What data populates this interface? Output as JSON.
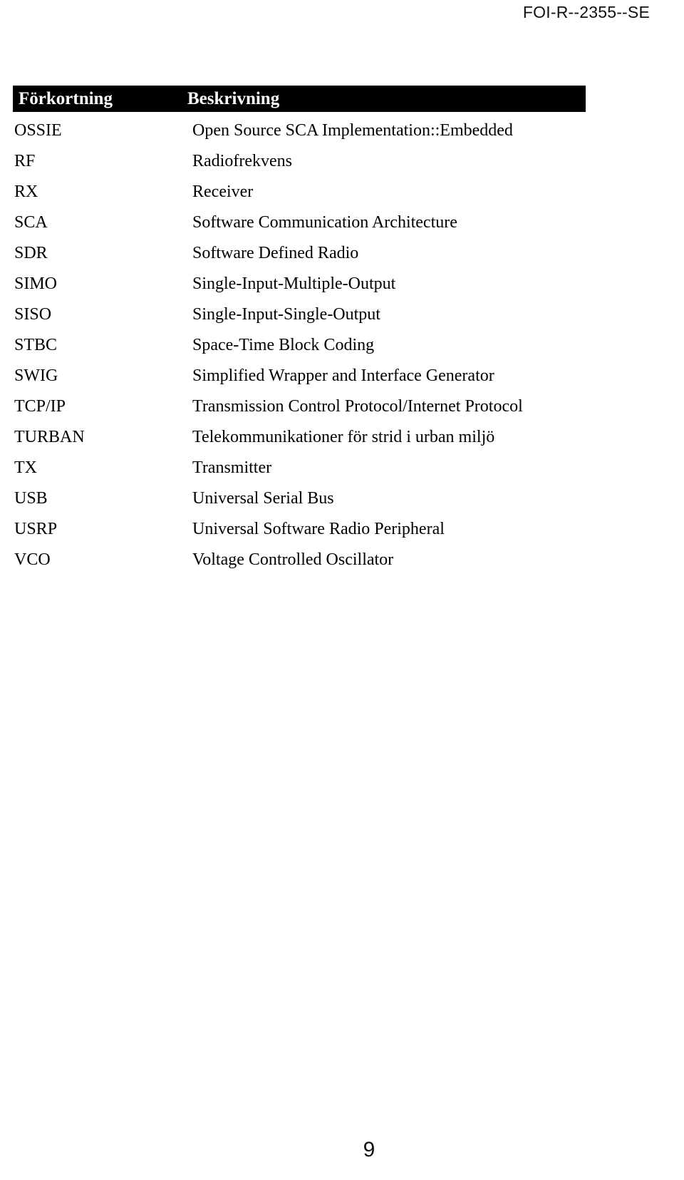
{
  "document": {
    "header_id": "FOI-R--2355--SE",
    "page_number": "9"
  },
  "table": {
    "columns": {
      "abbreviation": "Förkortning",
      "description": "Beskrivning"
    },
    "header_background": "#000000",
    "header_text_color": "#ffffff",
    "rows": [
      {
        "abbreviation": "OSSIE",
        "description": "Open Source SCA Implementation::Embedded"
      },
      {
        "abbreviation": "RF",
        "description": "Radiofrekvens"
      },
      {
        "abbreviation": "RX",
        "description": "Receiver"
      },
      {
        "abbreviation": "SCA",
        "description": "Software Communication Architecture"
      },
      {
        "abbreviation": "SDR",
        "description": "Software Defined Radio"
      },
      {
        "abbreviation": "SIMO",
        "description": "Single-Input-Multiple-Output"
      },
      {
        "abbreviation": "SISO",
        "description": "Single-Input-Single-Output"
      },
      {
        "abbreviation": "STBC",
        "description": "Space-Time Block Coding"
      },
      {
        "abbreviation": "SWIG",
        "description": "Simplified Wrapper and Interface Generator"
      },
      {
        "abbreviation": "TCP/IP",
        "description": "Transmission Control Protocol/Internet Protocol"
      },
      {
        "abbreviation": "TURBAN",
        "description": "Telekommunikationer för strid i urban miljö"
      },
      {
        "abbreviation": "TX",
        "description": "Transmitter"
      },
      {
        "abbreviation": "USB",
        "description": "Universal Serial Bus"
      },
      {
        "abbreviation": "USRP",
        "description": "Universal Software Radio Peripheral"
      },
      {
        "abbreviation": "VCO",
        "description": "Voltage Controlled Oscillator"
      }
    ]
  }
}
